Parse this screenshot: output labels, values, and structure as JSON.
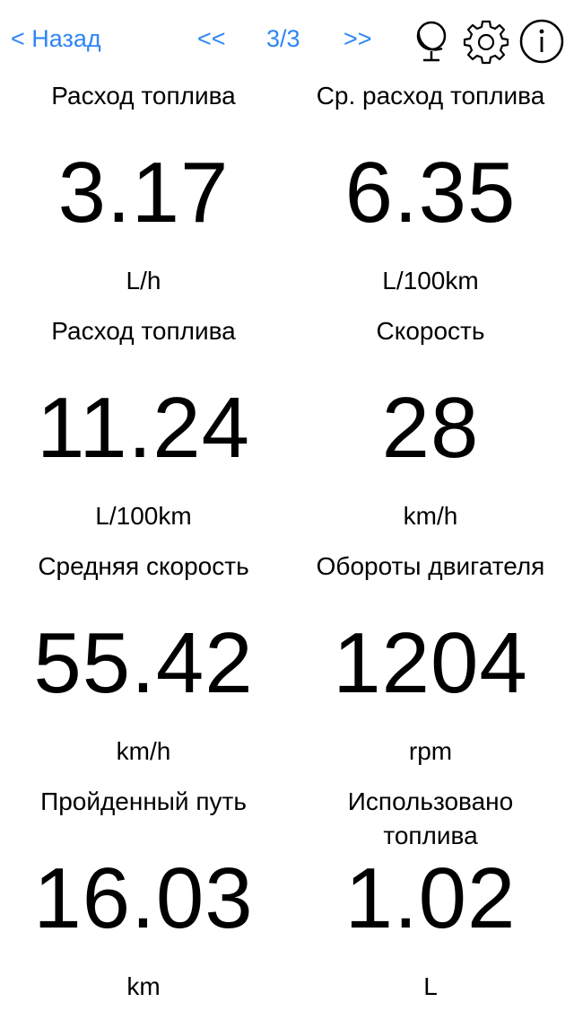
{
  "nav": {
    "back_label": "< Назад",
    "prev_label": "<<",
    "page_indicator": "3/3",
    "next_label": ">>",
    "icons": [
      "globe-icon",
      "gear-icon",
      "info-icon"
    ],
    "accent_color": "#2e86f5"
  },
  "metrics": [
    {
      "label": "Расход топлива",
      "value": "3.17",
      "unit": "L/h"
    },
    {
      "label": "Ср. расход топлива",
      "value": "6.35",
      "unit": "L/100km"
    },
    {
      "label": "Расход топлива",
      "value": "11.24",
      "unit": "L/100km"
    },
    {
      "label": "Скорость",
      "value": "28",
      "unit": "km/h"
    },
    {
      "label": "Средняя скорость",
      "value": "55.42",
      "unit": "km/h"
    },
    {
      "label": "Обороты двигателя",
      "value": "1204",
      "unit": "rpm"
    },
    {
      "label": "Пройденный путь",
      "value": "16.03",
      "unit": "km"
    },
    {
      "label": "Использовано топлива",
      "value": "1.02",
      "unit": "L"
    }
  ]
}
